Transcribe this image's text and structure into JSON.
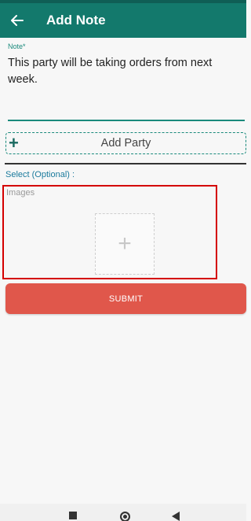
{
  "app_bar": {
    "title": "Add Note",
    "back_icon": "arrow-left-icon",
    "color": "#13796c"
  },
  "note": {
    "label": "Note*",
    "value": "This party will be taking orders from next week."
  },
  "add_party": {
    "label": "Add Party",
    "icon": "+"
  },
  "select": {
    "label": "Select (Optional) :"
  },
  "images": {
    "label": "Images",
    "add_icon": "+"
  },
  "submit": {
    "label": "SUBMIT",
    "color": "#e0574b"
  },
  "nav_bar": {
    "items": [
      "recents-icon",
      "home-icon",
      "back-icon"
    ]
  }
}
